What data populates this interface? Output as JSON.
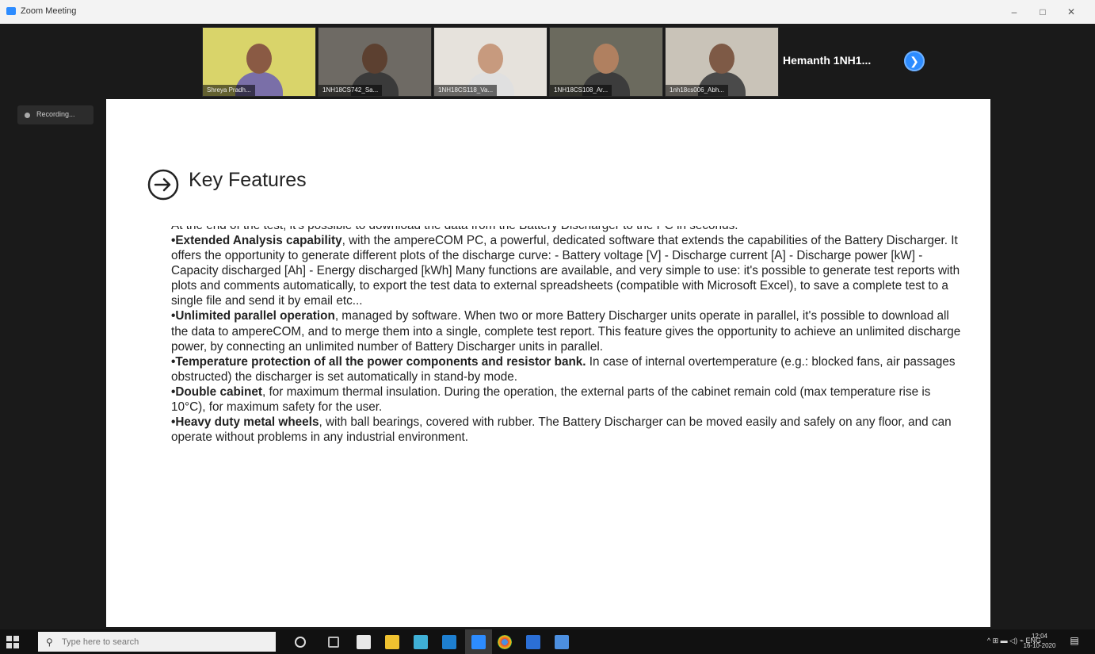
{
  "window": {
    "title": "Zoom Meeting",
    "minimize": "–",
    "maximize": "□",
    "close": "✕"
  },
  "participants": [
    {
      "name": "Shreya Pradh...",
      "bg": "#d9d46a",
      "skin": "#8a5a44",
      "shirt": "#7a6fa8"
    },
    {
      "name": "1NH18CS742_Sa...",
      "bg": "#6e6a64",
      "skin": "#5c4030",
      "shirt": "#3a3a3a"
    },
    {
      "name": "1NH18CS118_Va...",
      "bg": "#e6e2dc",
      "skin": "#c79a7e",
      "shirt": "#e0e0e0"
    },
    {
      "name": "1NH18CS108_Ar...",
      "bg": "#6b6a5e",
      "skin": "#b08060",
      "shirt": "#3c3c3c"
    },
    {
      "name": "1nh18cs006_Abh...",
      "bg": "#c9c3b8",
      "skin": "#7e5a46",
      "shirt": "#4a4a4a"
    }
  ],
  "active_speaker": "Hemanth 1NH1...",
  "recording_label": "Recording...",
  "slide": {
    "title": "Key Features",
    "clipped_line": "At the end of the test, it's possible to download the data from the Battery Discharger to the PC in seconds.",
    "items": [
      {
        "bold": "•Extended Analysis capability",
        "text": ", with the ampereCOM PC, a powerful, dedicated software that extends the capabilities of the Battery Discharger. It offers the opportunity to generate different plots of the discharge curve: - Battery voltage [V] - Discharge current [A] - Discharge power [kW] - Capacity discharged [Ah] - Energy discharged [kWh] Many functions are available, and very simple to use: it's possible to generate test reports with plots and comments automatically, to export the test data to external spreadsheets (compatible with Microsoft Excel), to save a complete test to a single file and send it by email etc..."
      },
      {
        "bold": "•Unlimited parallel operation",
        "text": ", managed by software. When two or more Battery Discharger units operate in parallel, it's possible to download all the data to ampereCOM, and to merge them into a single, complete test report. This feature gives the opportunity to achieve an unlimited discharge power, by connecting an unlimited number of Battery Discharger units in parallel."
      },
      {
        "bold": "•Temperature protection of all the power components and resistor bank.",
        "text": " In case of internal overtemperature (e.g.: blocked fans, air passages obstructed) the discharger is set automatically in stand-by mode."
      },
      {
        "bold": "•Double cabinet",
        "text": ", for maximum thermal insulation. During the operation, the external parts of the cabinet remain cold (max temperature rise is 10°C), for maximum safety for the user."
      },
      {
        "bold": "•Heavy duty metal wheels",
        "text": ", with ball bearings, covered with rubber. The Battery Discharger can be moved easily and safely on any floor, and can operate without problems in any industrial environment."
      }
    ]
  },
  "taskbar": {
    "search_placeholder": "Type here to search",
    "tray_text": "^  ⊞  ▬  ◁)  ⌁  ENG",
    "time": "12:04",
    "date": "16-10-2020"
  },
  "colors": {
    "zoom_blue": "#2d8cff",
    "taskbar": "#111111",
    "stage": "#1a1a1a"
  }
}
